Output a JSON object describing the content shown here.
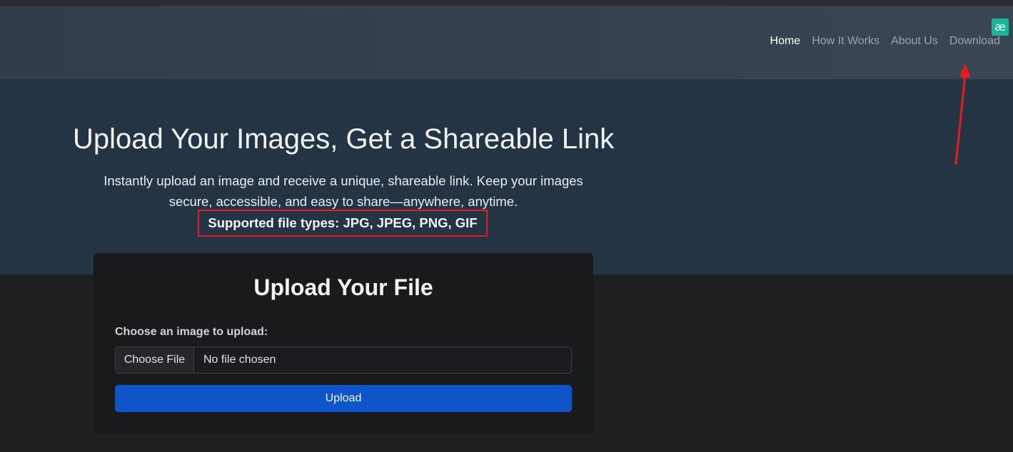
{
  "nav": {
    "links": [
      {
        "label": "Home",
        "active": true
      },
      {
        "label": "How It Works",
        "active": false
      },
      {
        "label": "About Us",
        "active": false
      },
      {
        "label": "Download",
        "active": false
      }
    ],
    "extension_badge": "æ"
  },
  "hero": {
    "title": "Upload Your Images, Get a Shareable Link",
    "description": "Instantly upload an image and receive a unique, shareable link. Keep your images secure, accessible, and easy to share—anywhere, anytime.",
    "supported_types": "Supported file types: JPG, JPEG, PNG, GIF"
  },
  "upload_card": {
    "title": "Upload Your File",
    "field_label": "Choose an image to upload:",
    "choose_button": "Choose File",
    "file_status": "No file chosen",
    "upload_button": "Upload"
  },
  "colors": {
    "annotation": "#e41c1c",
    "primary_button": "#0d55c9",
    "hero_bg": "#243445"
  }
}
